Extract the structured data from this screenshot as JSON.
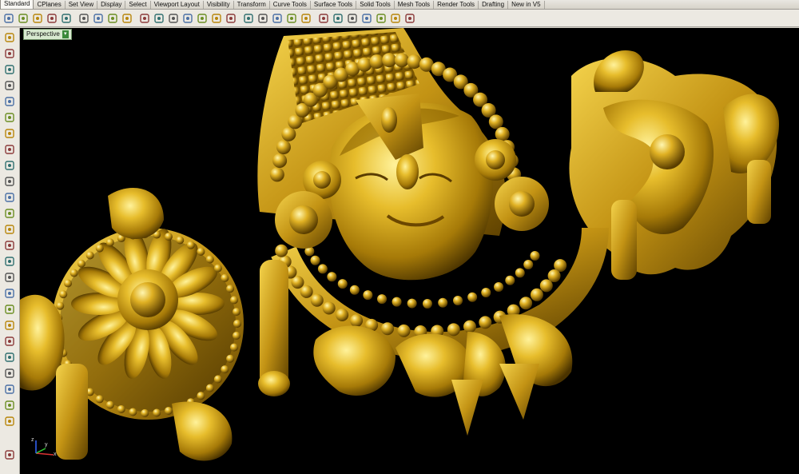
{
  "tabs": [
    {
      "label": "Standard",
      "active": true
    },
    {
      "label": "CPlanes"
    },
    {
      "label": "Set View"
    },
    {
      "label": "Display"
    },
    {
      "label": "Select"
    },
    {
      "label": "Viewport Layout"
    },
    {
      "label": "Visibility"
    },
    {
      "label": "Transform"
    },
    {
      "label": "Curve Tools"
    },
    {
      "label": "Surface Tools"
    },
    {
      "label": "Solid Tools"
    },
    {
      "label": "Mesh Tools"
    },
    {
      "label": "Render Tools"
    },
    {
      "label": "Drafting"
    },
    {
      "label": "New in V5"
    }
  ],
  "toolbar_icons": [
    "new-icon",
    "open-icon",
    "save-icon",
    "print-icon",
    "import-icon",
    "cut-icon",
    "copy-icon",
    "paste-icon",
    "undo-icon",
    "pan-icon",
    "move-view-icon",
    "rotate-view-icon",
    "zoom-icon",
    "zoom-extents-icon",
    "zoom-window-icon",
    "zoom-selected-icon",
    "four-viewports-icon",
    "cplane-icon",
    "grid-icon",
    "select-icon",
    "light-icon",
    "layer-icon",
    "color-wheel-icon",
    "render-icon",
    "material-icon",
    "options-icon",
    "osnap-icon",
    "help-icon"
  ],
  "left_icons": [
    "point-icon",
    "line-icon",
    "polyline-icon",
    "circle-icon",
    "arc-icon",
    "ellipse-icon",
    "polygon-icon",
    "rectangle-icon",
    "curve-icon",
    "fillet-icon",
    "surface-icon",
    "extrude-icon",
    "box-icon",
    "solid-icon",
    "mesh-icon",
    "edit-point-icon",
    "trim-icon",
    "split-icon",
    "join-icon",
    "explode-icon",
    "group-icon",
    "text-icon",
    "dimension-icon",
    "array-icon",
    "block-icon",
    "scroll-down-icon"
  ],
  "viewport": {
    "label": "Perspective",
    "dropdown_glyph": "▾",
    "background": "#000000",
    "model_color": "#c9a318"
  },
  "axes": {
    "x": "x",
    "y": "y",
    "z": "z"
  }
}
